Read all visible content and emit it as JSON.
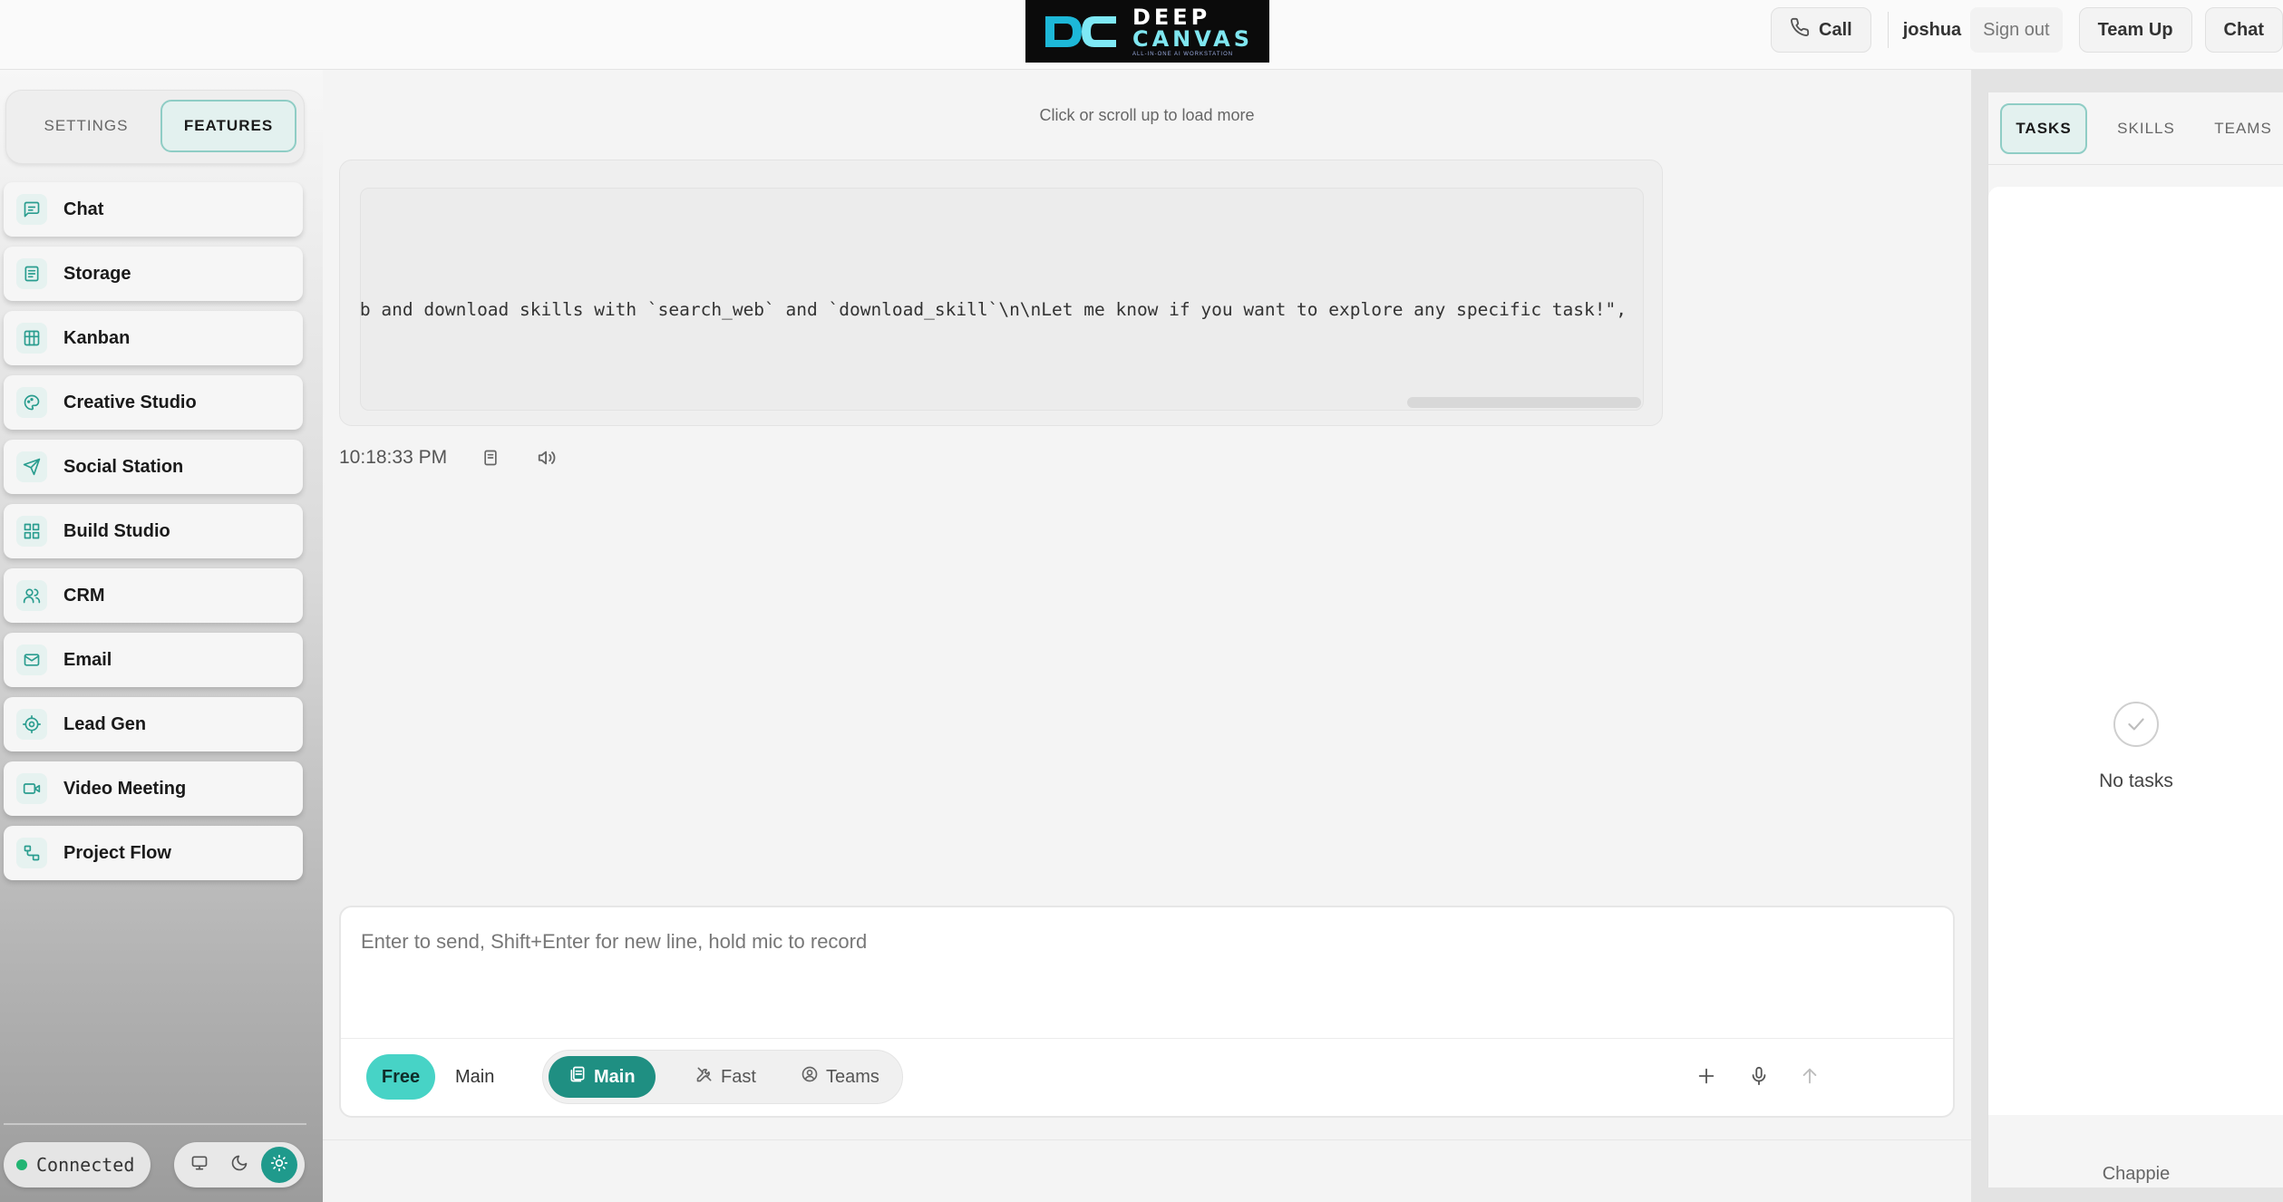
{
  "header": {
    "logo": {
      "line1": "DEEP",
      "line2": "CANVAS",
      "tagline": "ALL-IN-ONE AI WORKSTATION"
    },
    "call_label": "Call",
    "user_name": "joshua",
    "signout_label": "Sign out",
    "teamup_label": "Team Up",
    "chat_label": "Chat"
  },
  "sidebar": {
    "tabs": {
      "settings": "SETTINGS",
      "features": "FEATURES",
      "active": "FEATURES"
    },
    "items": [
      {
        "label": "Chat",
        "icon": "chat-icon"
      },
      {
        "label": "Storage",
        "icon": "storage-icon"
      },
      {
        "label": "Kanban",
        "icon": "kanban-icon"
      },
      {
        "label": "Creative Studio",
        "icon": "palette-icon"
      },
      {
        "label": "Social Station",
        "icon": "send-icon"
      },
      {
        "label": "Build Studio",
        "icon": "grid-icon"
      },
      {
        "label": "CRM",
        "icon": "users-icon"
      },
      {
        "label": "Email",
        "icon": "mail-icon"
      },
      {
        "label": "Lead Gen",
        "icon": "target-icon"
      },
      {
        "label": "Video Meeting",
        "icon": "video-icon"
      },
      {
        "label": "Project Flow",
        "icon": "flow-icon"
      }
    ],
    "status": "Connected",
    "theme_active": "light"
  },
  "chat": {
    "load_more": "Click or scroll up to load more",
    "message_code": "eb and download skills with `search_web` and `download_skill`\\n\\nLet me know if you want to explore any specific task!\",",
    "timestamp": "10:18:33 PM"
  },
  "composer": {
    "placeholder": "Enter to send, Shift+Enter for new line, hold mic to record",
    "value": "",
    "tier_free": "Free",
    "tier_main": "Main",
    "modes": {
      "main": "Main",
      "fast": "Fast",
      "teams": "Teams",
      "active": "Main"
    }
  },
  "right_panel": {
    "tabs": {
      "tasks": "TASKS",
      "skills": "SKILLS",
      "teams": "TEAMS",
      "active": "TASKS"
    },
    "empty_text": "No tasks",
    "footer": "Chappie"
  },
  "colors": {
    "accent": "#1f8f82",
    "accent_light": "#47d3c6",
    "status_green": "#22b573"
  }
}
